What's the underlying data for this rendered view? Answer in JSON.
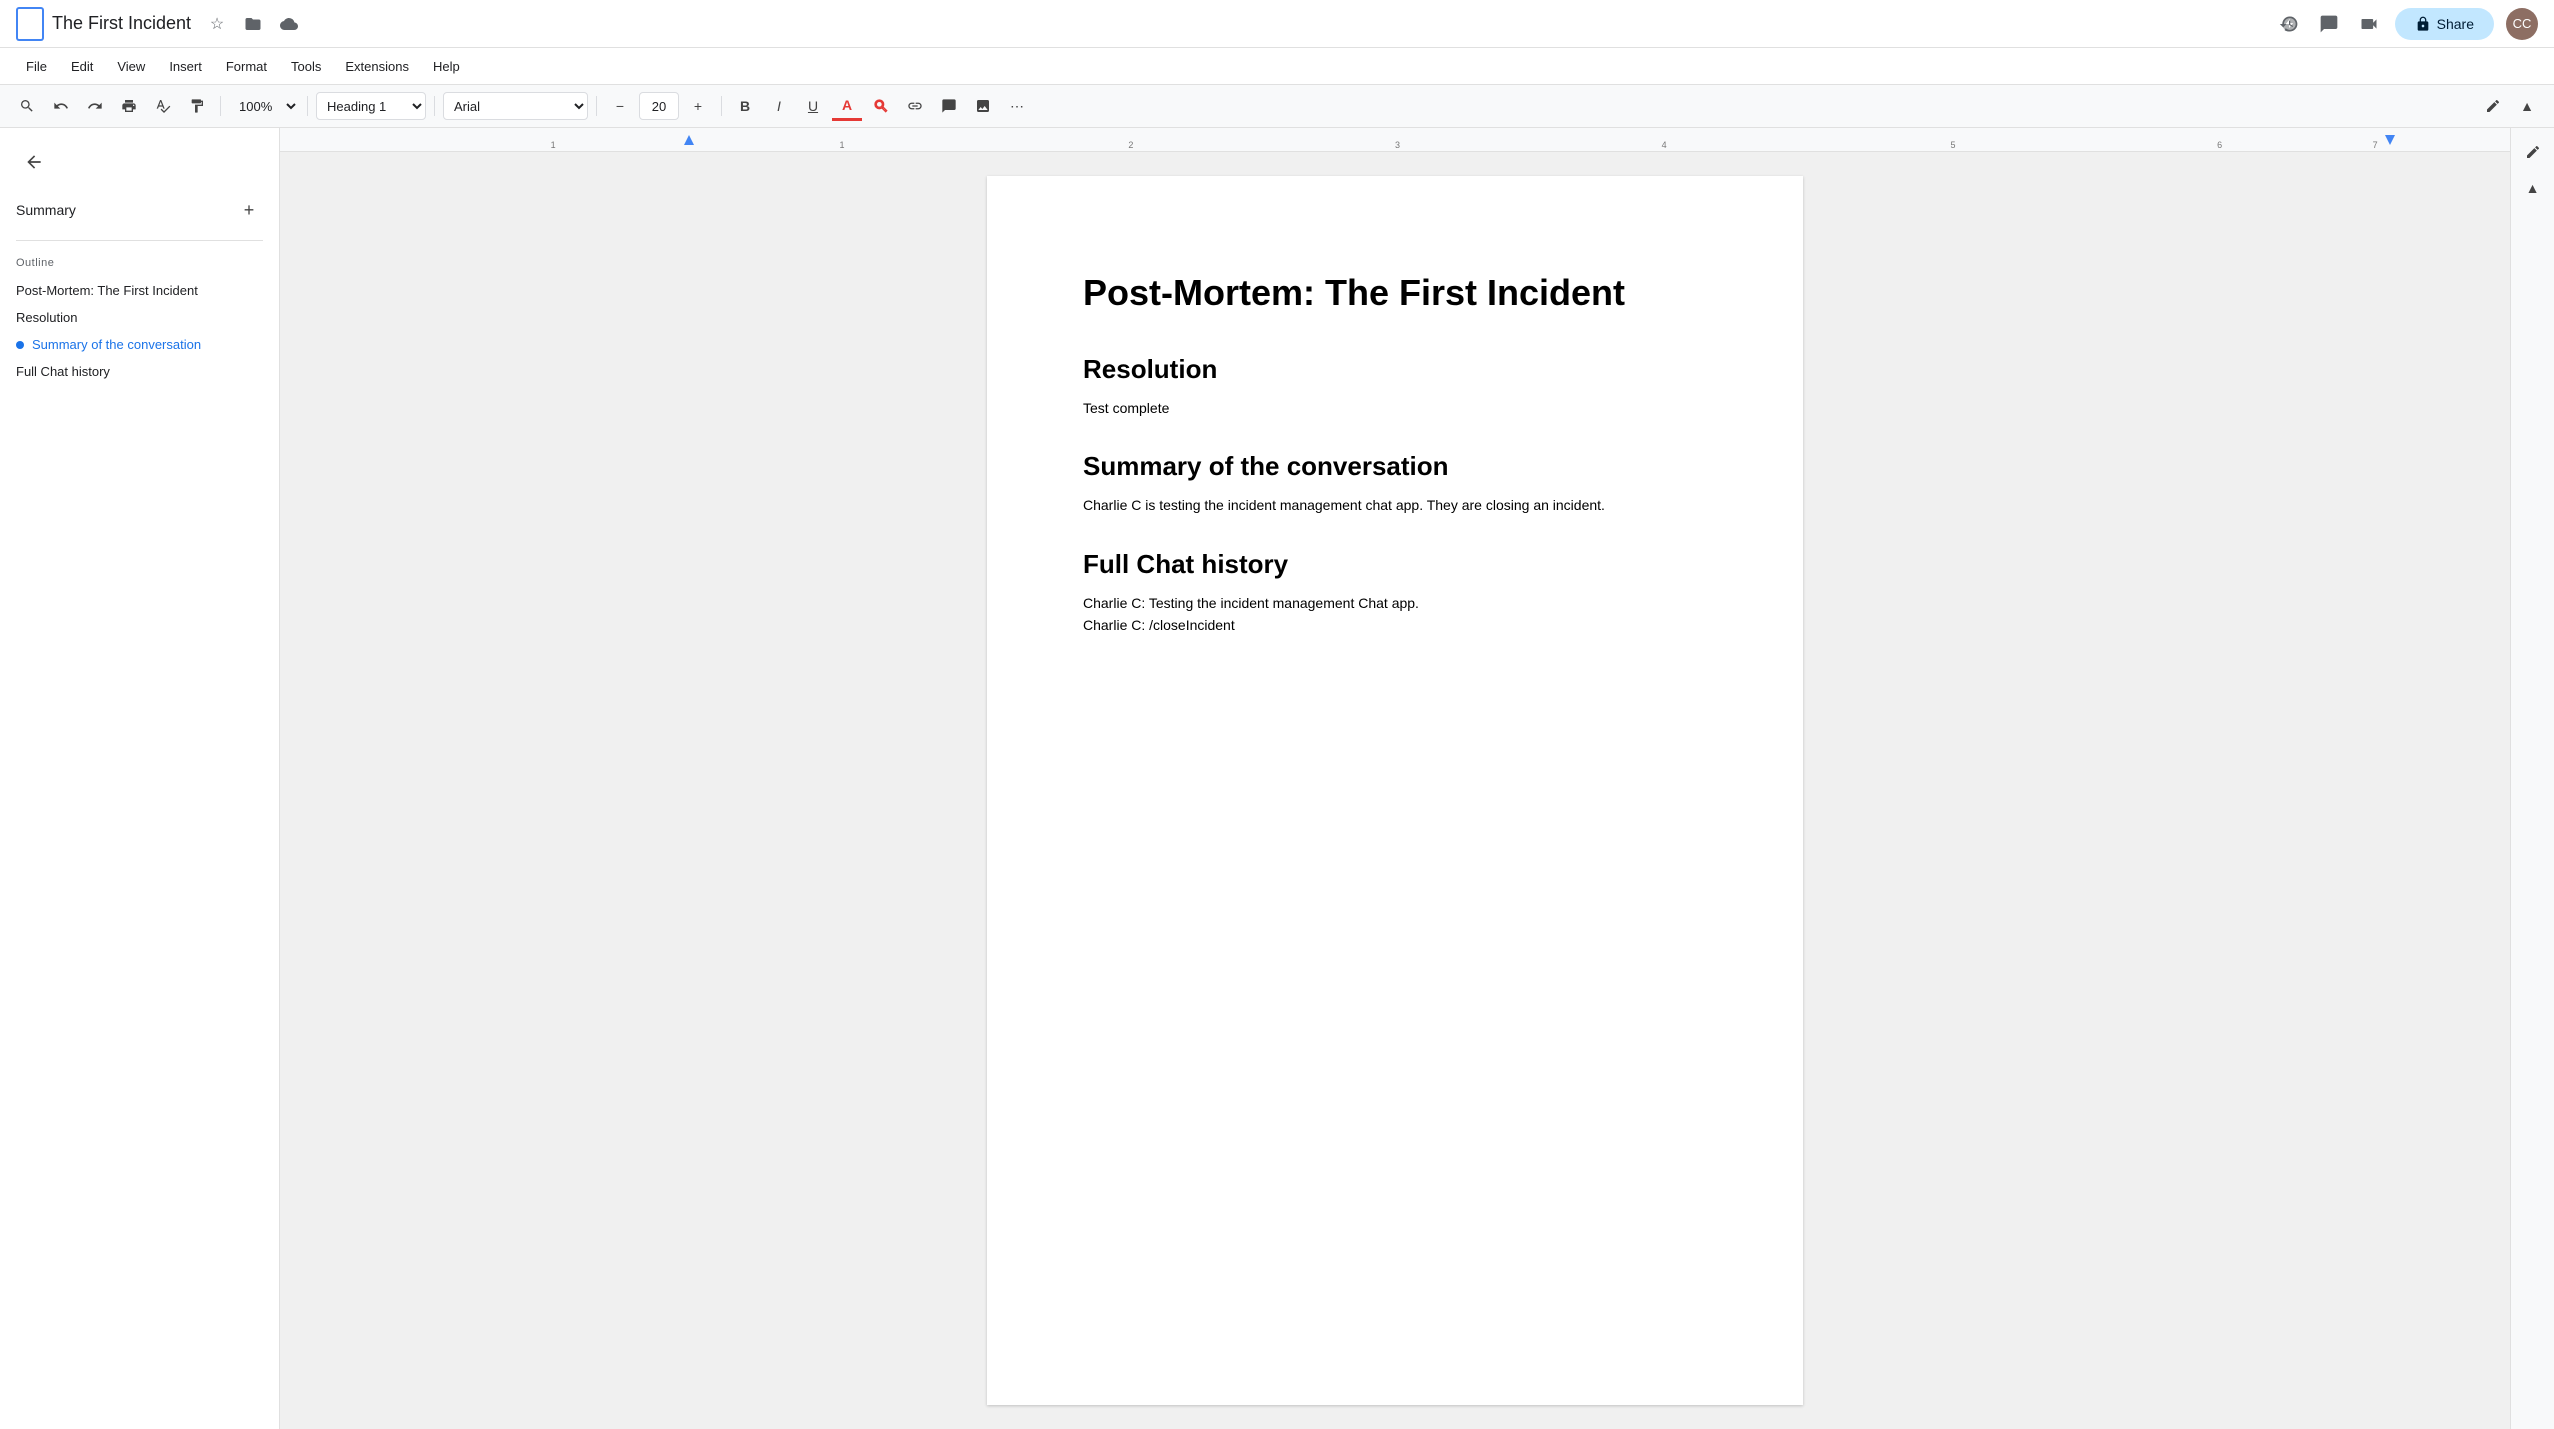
{
  "titlebar": {
    "doc_title": "The First Incident",
    "star_icon": "★",
    "folder_icon": "📁",
    "cloud_icon": "☁",
    "history_icon": "🕐",
    "comment_icon": "💬",
    "video_icon": "📹",
    "share_label": "Share",
    "lock_icon": "🔒",
    "avatar_initials": "CC"
  },
  "menubar": {
    "items": [
      "File",
      "Edit",
      "View",
      "Insert",
      "Format",
      "Tools",
      "Extensions",
      "Help"
    ]
  },
  "toolbar": {
    "zoom_value": "100%",
    "style_value": "Heading 1",
    "font_value": "Arial",
    "font_size": "20",
    "bold_label": "B",
    "italic_label": "I",
    "underline_label": "U"
  },
  "sidebar": {
    "back_icon": "←",
    "summary_label": "Summary",
    "add_icon": "+",
    "outline_label": "Outline",
    "outline_items": [
      {
        "id": "item-main-title",
        "text": "Post-Mortem: The First Incident",
        "active": false
      },
      {
        "id": "item-resolution",
        "text": "Resolution",
        "active": false
      },
      {
        "id": "item-summary",
        "text": "Summary of the conversation",
        "active": true
      },
      {
        "id": "item-full-chat",
        "text": "Full Chat history",
        "active": false
      }
    ]
  },
  "document": {
    "main_title": "Post-Mortem: The First Incident",
    "sections": [
      {
        "heading": "Resolution",
        "body_lines": [
          "Test complete"
        ]
      },
      {
        "heading": "Summary of the conversation",
        "body_lines": [
          "Charlie C is testing the incident management chat app. They are closing an incident."
        ]
      },
      {
        "heading": "Full Chat history",
        "body_lines": [
          "Charlie C: Testing the incident management Chat app.",
          "Charlie C: /closeIncident"
        ]
      }
    ]
  },
  "colors": {
    "active_outline": "#1a73e8",
    "share_btn_bg": "#c2e7ff",
    "doc_icon_bg": "#4285f4"
  }
}
